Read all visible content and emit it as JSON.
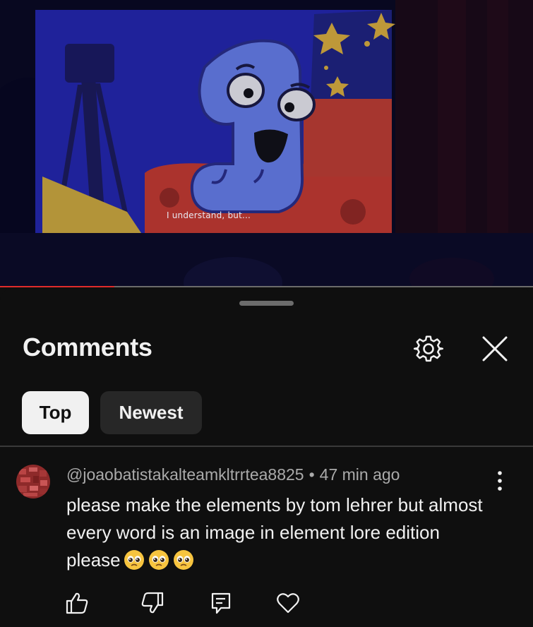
{
  "video": {
    "subtitle": "I understand, but...",
    "progress_fraction": 0.215
  },
  "comments_panel": {
    "title": "Comments",
    "settings_icon": "gear-icon",
    "close_icon": "close-icon",
    "sort_tabs": [
      {
        "label": "Top",
        "selected": true
      },
      {
        "label": "Newest",
        "selected": false
      }
    ]
  },
  "comment": {
    "author": "@joaobatistakalteamkltrrtea8825",
    "separator": "•",
    "time": "47 min ago",
    "text": "please make the elements by tom lehrer but almost every word is an image in element lore edition please",
    "emojis": [
      "pleading-face",
      "pleading-face",
      "pleading-face"
    ],
    "actions": [
      "thumbs-up-icon",
      "thumbs-down-icon",
      "reply-icon",
      "heart-icon"
    ]
  },
  "colors": {
    "background": "#0f0f0f",
    "progress": "#e02b2b",
    "chip_selected_bg": "#f1f1f1",
    "chip_bg": "#272727",
    "meta_text": "#aaaaaa"
  }
}
